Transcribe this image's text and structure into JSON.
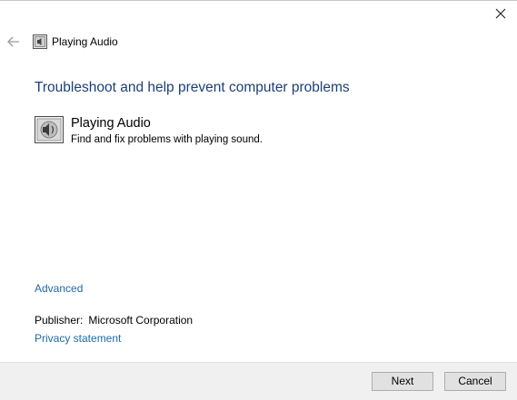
{
  "window": {
    "title": "Playing Audio"
  },
  "icons": {
    "close": "close-icon",
    "back": "back-arrow-icon",
    "app": "audio-troubleshooter-icon"
  },
  "main": {
    "heading": "Troubleshoot and help prevent computer problems",
    "item_title": "Playing Audio",
    "item_description": "Find and fix problems with playing sound.",
    "advanced_link": "Advanced",
    "publisher_label": "Publisher:",
    "publisher_value": "Microsoft Corporation",
    "privacy_link": "Privacy statement"
  },
  "footer": {
    "next_label": "Next",
    "cancel_label": "Cancel"
  },
  "colors": {
    "heading": "#1c3f7a",
    "link": "#1e6aa6",
    "footer_bg": "#f0f0f0"
  }
}
